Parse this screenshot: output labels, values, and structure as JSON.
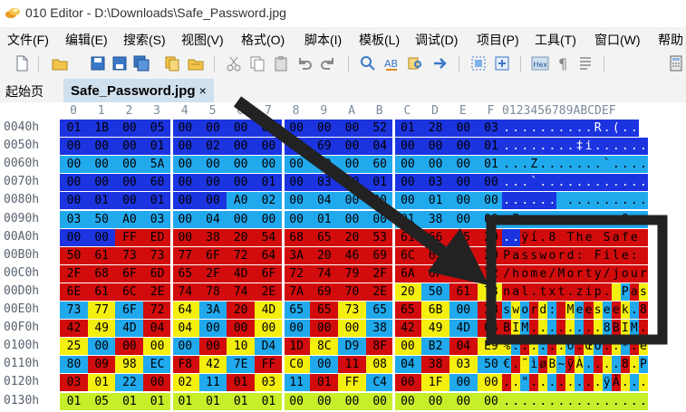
{
  "window": {
    "title": "010 Editor - D:\\Downloads\\Safe_Password.jpg",
    "logo_icon": "010-editor-logo-icon"
  },
  "menu": [
    "文件(F)",
    "编辑(E)",
    "搜索(S)",
    "视图(V)",
    "格式(O)",
    "脚本(I)",
    "模板(L)",
    "调试(D)",
    "项目(P)",
    "工具(T)",
    "窗口(W)",
    "帮助"
  ],
  "toolbar": {
    "icons": [
      "new-file-icon",
      "open-folder-icon",
      "save-icon",
      "save-as-icon",
      "save-all-icon",
      "copy-files-icon",
      "open-folder-2-icon",
      "cut-icon",
      "copy-icon",
      "paste-icon",
      "undo-icon",
      "redo-icon",
      "find-icon",
      "replace-icon",
      "find-in-files-icon",
      "goto-icon",
      "select-all-icon",
      "insert-icon",
      "hex-icon",
      "pilcrow-icon",
      "text-mode-icon",
      "calculator-icon"
    ],
    "hex_label": "Hex"
  },
  "tabs": {
    "start_page": "起始页",
    "active_file": "Safe_Password.jpg",
    "close_glyph": "×"
  },
  "hex": {
    "column_headers": [
      "0",
      "1",
      "2",
      "3",
      "4",
      "5",
      "6",
      "7",
      "8",
      "9",
      "A",
      "B",
      "C",
      "D",
      "E",
      "F"
    ],
    "ascii_header": "0123456789ABCDEF",
    "rows": [
      {
        "addr": "0040h",
        "bytes": [
          "01",
          "1B",
          "00",
          "05",
          "00",
          "00",
          "00",
          "01",
          "00",
          "00",
          "00",
          "52",
          "01",
          "28",
          "00",
          "03"
        ],
        "colors": [
          "b",
          "b",
          "b",
          "b",
          "b",
          "b",
          "b",
          "b",
          "b",
          "b",
          "b",
          "b",
          "b",
          "b",
          "b",
          "b"
        ],
        "ascii": "..........R.(.."
      },
      {
        "addr": "0050h",
        "bytes": [
          "00",
          "00",
          "00",
          "01",
          "00",
          "02",
          "00",
          "00",
          "87",
          "69",
          "00",
          "04",
          "00",
          "00",
          "00",
          "01"
        ],
        "colors": [
          "b",
          "b",
          "b",
          "b",
          "b",
          "b",
          "b",
          "b",
          "b",
          "b",
          "b",
          "b",
          "b",
          "b",
          "b",
          "b"
        ],
        "ascii": "........‡i......"
      },
      {
        "addr": "0060h",
        "bytes": [
          "00",
          "00",
          "00",
          "5A",
          "00",
          "00",
          "00",
          "00",
          "00",
          "00",
          "00",
          "60",
          "00",
          "00",
          "00",
          "01"
        ],
        "colors": [
          "c",
          "c",
          "c",
          "c",
          "c",
          "c",
          "c",
          "c",
          "c",
          "c",
          "c",
          "c",
          "c",
          "c",
          "c",
          "c"
        ],
        "ascii": "...Z.......`...."
      },
      {
        "addr": "0070h",
        "bytes": [
          "00",
          "00",
          "00",
          "60",
          "00",
          "00",
          "00",
          "01",
          "00",
          "03",
          "A0",
          "01",
          "00",
          "03",
          "00",
          "00"
        ],
        "colors": [
          "b",
          "b",
          "b",
          "b",
          "b",
          "b",
          "b",
          "b",
          "b",
          "b",
          "b",
          "b",
          "b",
          "b",
          "b",
          "b"
        ],
        "ascii": "...`............"
      },
      {
        "addr": "0080h",
        "bytes": [
          "00",
          "01",
          "00",
          "01",
          "00",
          "00",
          "A0",
          "02",
          "00",
          "04",
          "00",
          "00",
          "00",
          "01",
          "00",
          "00"
        ],
        "colors": [
          "b",
          "b",
          "b",
          "b",
          "b",
          "b",
          "c",
          "c",
          "c",
          "c",
          "c",
          "c",
          "c",
          "c",
          "c",
          "c"
        ],
        "ascii": "...... ........."
      },
      {
        "addr": "0090h",
        "bytes": [
          "03",
          "50",
          "A0",
          "03",
          "00",
          "04",
          "00",
          "00",
          "00",
          "01",
          "00",
          "00",
          "01",
          "38",
          "00",
          "00"
        ],
        "colors": [
          "c",
          "c",
          "c",
          "c",
          "c",
          "c",
          "c",
          "c",
          "c",
          "c",
          "c",
          "c",
          "c",
          "c",
          "c",
          "c"
        ],
        "ascii": ".P. .........8.."
      },
      {
        "addr": "00A0h",
        "bytes": [
          "00",
          "00",
          "FF",
          "ED",
          "00",
          "38",
          "20",
          "54",
          "68",
          "65",
          "20",
          "53",
          "61",
          "66",
          "65",
          "20"
        ],
        "colors": [
          "b",
          "b",
          "r",
          "r",
          "r",
          "r",
          "r",
          "r",
          "r",
          "r",
          "r",
          "r",
          "r",
          "r",
          "r",
          "r"
        ],
        "ascii": "..ÿí.8 The Safe "
      },
      {
        "addr": "00B0h",
        "bytes": [
          "50",
          "61",
          "73",
          "73",
          "77",
          "6F",
          "72",
          "64",
          "3A",
          "20",
          "46",
          "69",
          "6C",
          "65",
          "3A",
          "20"
        ],
        "colors": [
          "r",
          "r",
          "r",
          "r",
          "r",
          "r",
          "r",
          "r",
          "r",
          "r",
          "r",
          "r",
          "r",
          "r",
          "r",
          "r"
        ],
        "ascii": "Password: File: "
      },
      {
        "addr": "00C0h",
        "bytes": [
          "2F",
          "68",
          "6F",
          "6D",
          "65",
          "2F",
          "4D",
          "6F",
          "72",
          "74",
          "79",
          "2F",
          "6A",
          "6F",
          "75",
          "72"
        ],
        "colors": [
          "r",
          "r",
          "r",
          "r",
          "r",
          "r",
          "r",
          "r",
          "r",
          "r",
          "r",
          "r",
          "r",
          "r",
          "r",
          "r"
        ],
        "ascii": "/home/Morty/jour"
      },
      {
        "addr": "00D0h",
        "bytes": [
          "6E",
          "61",
          "6C",
          "2E",
          "74",
          "78",
          "74",
          "2E",
          "7A",
          "69",
          "70",
          "2E",
          "20",
          "50",
          "61",
          "73"
        ],
        "colors": [
          "r",
          "r",
          "r",
          "r",
          "r",
          "r",
          "r",
          "r",
          "r",
          "r",
          "r",
          "r",
          "y",
          "c",
          "r",
          "y"
        ],
        "ascii": "nal.txt.zip. Pas"
      },
      {
        "addr": "00E0h",
        "bytes": [
          "73",
          "77",
          "6F",
          "72",
          "64",
          "3A",
          "20",
          "4D",
          "65",
          "65",
          "73",
          "65",
          "65",
          "6B",
          "00",
          "38"
        ],
        "colors": [
          "c",
          "y",
          "c",
          "r",
          "y",
          "c",
          "r",
          "y",
          "c",
          "r",
          "y",
          "c",
          "r",
          "y",
          "c",
          "r"
        ],
        "ascii": "sword: Meeseek.8"
      },
      {
        "addr": "00F0h",
        "bytes": [
          "42",
          "49",
          "4D",
          "04",
          "04",
          "00",
          "00",
          "00",
          "00",
          "00",
          "00",
          "38",
          "42",
          "49",
          "4D",
          "04"
        ],
        "colors": [
          "r",
          "y",
          "c",
          "r",
          "y",
          "c",
          "r",
          "y",
          "c",
          "r",
          "y",
          "c",
          "r",
          "y",
          "c",
          "r"
        ],
        "ascii": "BIM........8BIM."
      },
      {
        "addr": "0100h",
        "bytes": [
          "25",
          "00",
          "00",
          "00",
          "00",
          "00",
          "10",
          "D4",
          "1D",
          "8C",
          "D9",
          "8F",
          "00",
          "B2",
          "04",
          "E9"
        ],
        "colors": [
          "y",
          "c",
          "r",
          "y",
          "c",
          "r",
          "y",
          "c",
          "r",
          "y",
          "c",
          "r",
          "y",
          "c",
          "r",
          "y"
        ],
        "ascii": "%......Ô.ŒÙ..².é"
      },
      {
        "addr": "0110h",
        "bytes": [
          "80",
          "09",
          "98",
          "EC",
          "F8",
          "42",
          "7E",
          "FF",
          "C0",
          "00",
          "11",
          "08",
          "04",
          "38",
          "03",
          "50"
        ],
        "colors": [
          "c",
          "r",
          "y",
          "c",
          "r",
          "y",
          "c",
          "r",
          "y",
          "c",
          "r",
          "y",
          "c",
          "r",
          "y",
          "c"
        ],
        "ascii": "€.˜ìøB~ÿÀ....8.P"
      },
      {
        "addr": "0120h",
        "bytes": [
          "03",
          "01",
          "22",
          "00",
          "02",
          "11",
          "01",
          "03",
          "11",
          "01",
          "FF",
          "C4",
          "00",
          "1F",
          "00",
          "00"
        ],
        "colors": [
          "r",
          "y",
          "c",
          "r",
          "y",
          "c",
          "r",
          "y",
          "c",
          "r",
          "y",
          "c",
          "r",
          "y",
          "c",
          "y"
        ],
        "ascii": "..\"........ÿÄ..."
      },
      {
        "addr": "0130h",
        "bytes": [
          "01",
          "05",
          "01",
          "01",
          "01",
          "01",
          "01",
          "01",
          "00",
          "00",
          "00",
          "00",
          "00",
          "00",
          "00",
          "00"
        ],
        "colors": [
          "g",
          "g",
          "g",
          "g",
          "g",
          "g",
          "g",
          "g",
          "g",
          "g",
          "g",
          "g",
          "g",
          "g",
          "g",
          "g"
        ],
        "ascii": "................"
      }
    ]
  },
  "palette": {
    "b": "#1c34e0",
    "c": "#21a9ee",
    "r": "#d20c0c",
    "y": "#f5ef10",
    "g": "#c6ee29",
    "ascii_b": "#1c34e0",
    "arrow": "#222222"
  }
}
